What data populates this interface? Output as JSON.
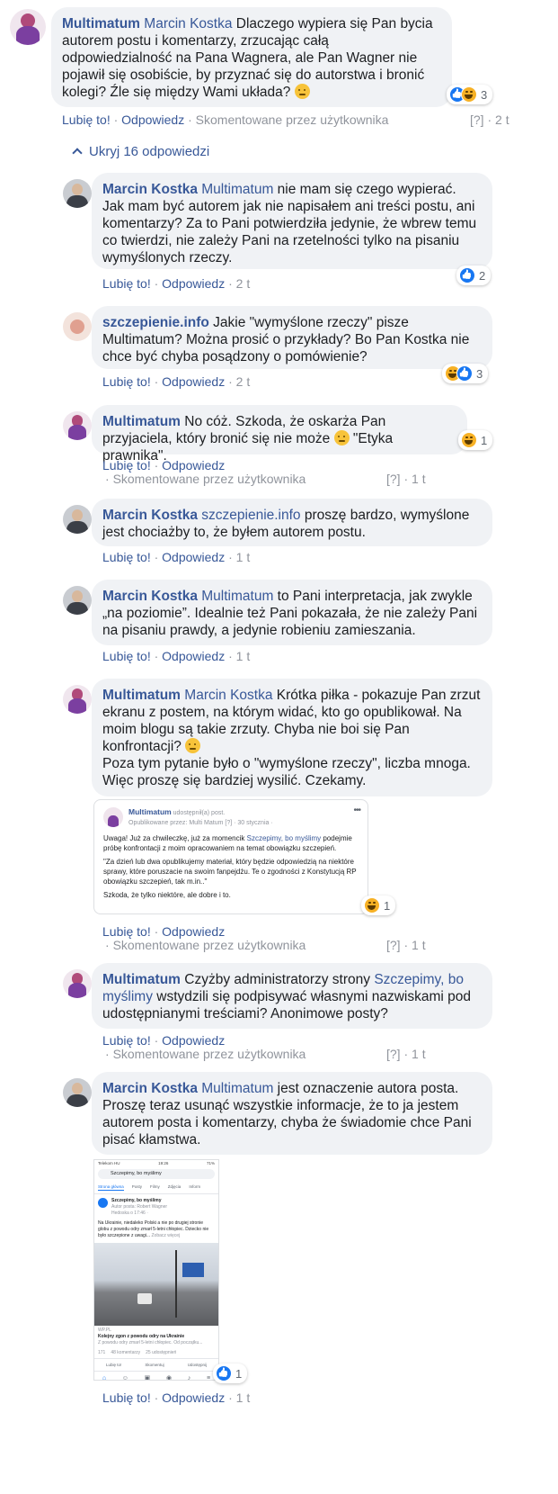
{
  "labels": {
    "like": "Lubię to!",
    "reply": "Odpowiedz",
    "commented_by": "Skomentowane przez użytkownika",
    "help": "[?]",
    "dot": "·",
    "hide_replies": "Ukryj 16 odpowiedzi"
  },
  "comments": [
    {
      "author": "Multimatum",
      "mention": "Marcin Kostka",
      "text": " Dlaczego wypiera się Pan bycia autorem postu i komentarzy, zrzucając całą odpowiedzialność na Pana Wagnera, ale Pan Wagner nie pojawił się osobiście, by przyznać się do autorstwa i bronić kolegi? Źle się między Wami układa?",
      "reaction_count": "3",
      "time": "2 t"
    },
    {
      "author": "Marcin Kostka",
      "mention": "Multimatum",
      "text": " nie mam się czego wypierać. Jak mam być autorem jak nie napisałem ani treści postu, ani komentarzy? Za to Pani potwierdziła jedynie, że wbrew temu co twierdzi, nie zależy Pani na rzetelności tylko na pisaniu wymyślonych rzeczy.",
      "reaction_count": "2",
      "time": "2 t"
    },
    {
      "author": "szczepienie.info",
      "text": " Jakie \"wymyślone rzeczy\" pisze Multimatum? Można prosić o przykłady? Bo Pan Kostka nie chce być chyba posądzony o pomówienie?",
      "reaction_count": "3",
      "time": "2 t"
    },
    {
      "author": "Multimatum",
      "text": " No cóż. Szkoda, że oskarża Pan przyjaciela, który bronić się nie może",
      "text_after": " \"Etyka prawnika\".",
      "reaction_count": "1",
      "time": "1 t"
    },
    {
      "author": "Marcin Kostka",
      "mention": "szczepienie.info",
      "text": " proszę bardzo, wymyślone jest chociażby to, że byłem autorem postu.",
      "time": "1 t"
    },
    {
      "author": "Marcin Kostka",
      "mention": "Multimatum",
      "text": " to Pani interpretacja, jak zwykle „na poziomie”. Idealnie też Pani pokazała, że nie zależy Pani na pisaniu prawdy, a jedynie robieniu zamieszania.",
      "time": "1 t"
    },
    {
      "author": "Multimatum",
      "mention": "Marcin Kostka",
      "text": " Krótka piłka - pokazuje Pan zrzut ekranu z postem, na którym widać, kto go opublikował. Na moim blogu są takie zrzuty. Chyba nie boi się Pan konfrontacji?",
      "text_line2": "Poza tym pytanie było o \"wymyślone rzeczy\", liczba mnoga. Więc proszę się bardziej wysilić. Czekamy.",
      "reaction_count": "1",
      "time": "1 t"
    },
    {
      "author": "Multimatum",
      "text": " Czyżby administratorzy strony ",
      "mention": "Szczepimy, bo myślimy",
      "text_after": " wstydzili się podpisywać własnymi nazwiskami pod udostępnianymi treściami? Anonimowe posty?",
      "time": "1 t"
    },
    {
      "author": "Marcin Kostka",
      "mention": "Multimatum",
      "text": " jest oznaczenie autora posta. Proszę teraz usunąć wszystkie informacje, że to ja jestem autorem posta i komentarzy, chyba że świadomie chce Pani pisać kłamstwa.",
      "reaction_count": "1",
      "time": "1 t"
    }
  ],
  "shared_card": {
    "name": "Multimatum",
    "action": " udostępnił(a) post.",
    "meta": "Opublikowane przez: Multi Matum [?] · 30 stycznia ·",
    "p1_a": "Uwaga! Już za chwileczkę, już za momencik ",
    "p1_link": "Szczepimy, bo myślimy",
    "p1_b": " podejmie próbę konfrontacji z moim opracowaniem na temat obowiązku szczepień.",
    "p2": "\"Za dzień lub dwa opublikujemy materiał, który będzie odpowiedzią na niektóre sprawy, które poruszacie na swoim fanpejdżu. Te o zgodności z Konstytucją RP obowiązku szczepień, tak m.in..\"",
    "p3": "Szkoda, że tylko niektóre, ale dobre i to."
  },
  "phone": {
    "carrier": "Telekom HU",
    "clock": "19:26",
    "battery": "71%",
    "search": "Szczepimy, bo myślimy",
    "tabs": [
      "Strona główna",
      "Posty",
      "Filmy",
      "Zdjęcia",
      "Inform"
    ],
    "page_name": "Szczepimy, bo myślimy",
    "page_meta": "Autor posta: Robert Wagner",
    "post_date": "Hedoska o 17:46 ·",
    "post_text": "Na Ukrainie, niedaleko Polski a nie po drugiej stronie globu z powodu odry zmarł 5-letni chłopiec. Dziecko nie było szczepione z uwagi...",
    "more": "Zobacz więcej",
    "source": "WP.PL",
    "caption_title": "Kolejny zgon z powodu odry na Ukrainie",
    "caption_sub": "Z powodu odry zmarł 5-letni chłopiec. Od początku...",
    "count_reactions": "171",
    "count_comments": "48 komentarzy",
    "count_shares": "25 udostępnień",
    "act_like": "Lubię to!",
    "act_comment": "Skomentuj",
    "act_share": "Udostępnij"
  },
  "colors": {
    "link": "#385898",
    "bubble_bg": "#f0f2f5",
    "meta": "#90949c",
    "like_blue": "#1877f2",
    "haha_yellow": "#f7b125"
  }
}
